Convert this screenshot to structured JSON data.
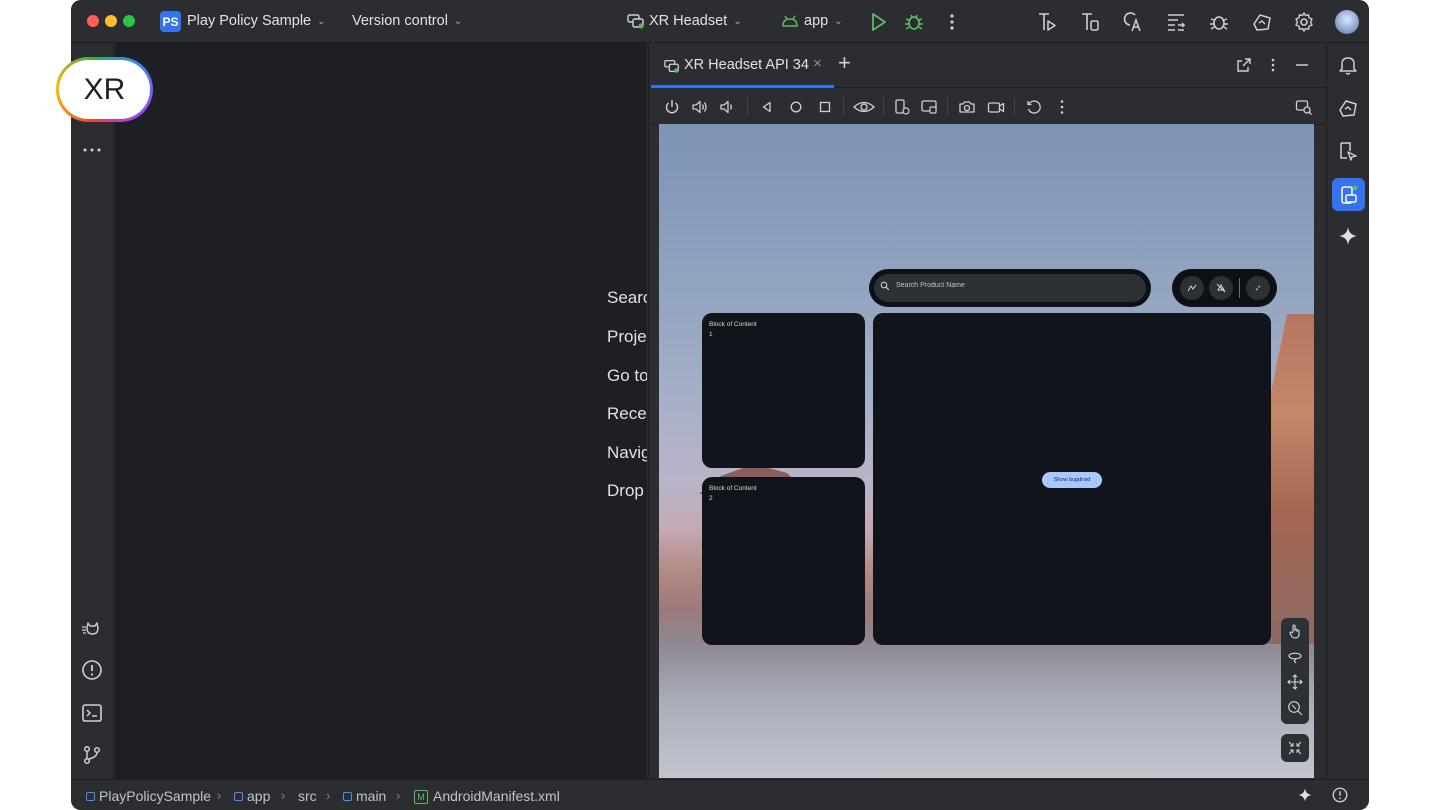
{
  "titlebar": {
    "project_badge": "PS",
    "project_name": "Play Policy Sample",
    "vcs": "Version control",
    "device": "XR Headset",
    "run_config": "app",
    "traffic_colors": [
      "#ff5f57",
      "#febc2e",
      "#28c840"
    ]
  },
  "xr_badge": "XR",
  "editor": {
    "hints": [
      "Searc",
      "Proje",
      "Go to",
      "Recer",
      "Navig",
      "Drop"
    ]
  },
  "running_devices": {
    "tab_label": "XR Headset API 34",
    "add_tab": "+"
  },
  "emulator": {
    "search_placeholder": "Search Product Name",
    "block1": "Block of Content\n1",
    "block2": "Block of Content\n2",
    "button": "Show bugdroid"
  },
  "statusbar": {
    "crumbs": [
      "PlayPolicySample",
      "app",
      "src",
      "main",
      "AndroidManifest.xml"
    ],
    "manifest_badge": "M"
  },
  "colors": {
    "accent": "#3574f0",
    "window_bg": "#2b2d30",
    "editor_bg": "#1e1f22",
    "button_fill": "#a8c7fa"
  },
  "icons": {
    "toolbar_right": [
      "project-sync-icon",
      "build-icon",
      "translate-icon",
      "logcat-icon",
      "bug-report-icon",
      "gemini-device-icon",
      "settings-gear-icon",
      "avatar"
    ],
    "left_strip": [
      "more-icon",
      "cat-icon",
      "problems-icon",
      "terminal-icon",
      "git-branch-icon"
    ],
    "right_strip": [
      "notifications-bell-icon",
      "device-manager-icon",
      "inspector-icon",
      "running-devices-icon",
      "gemini-sparkle-icon"
    ]
  }
}
